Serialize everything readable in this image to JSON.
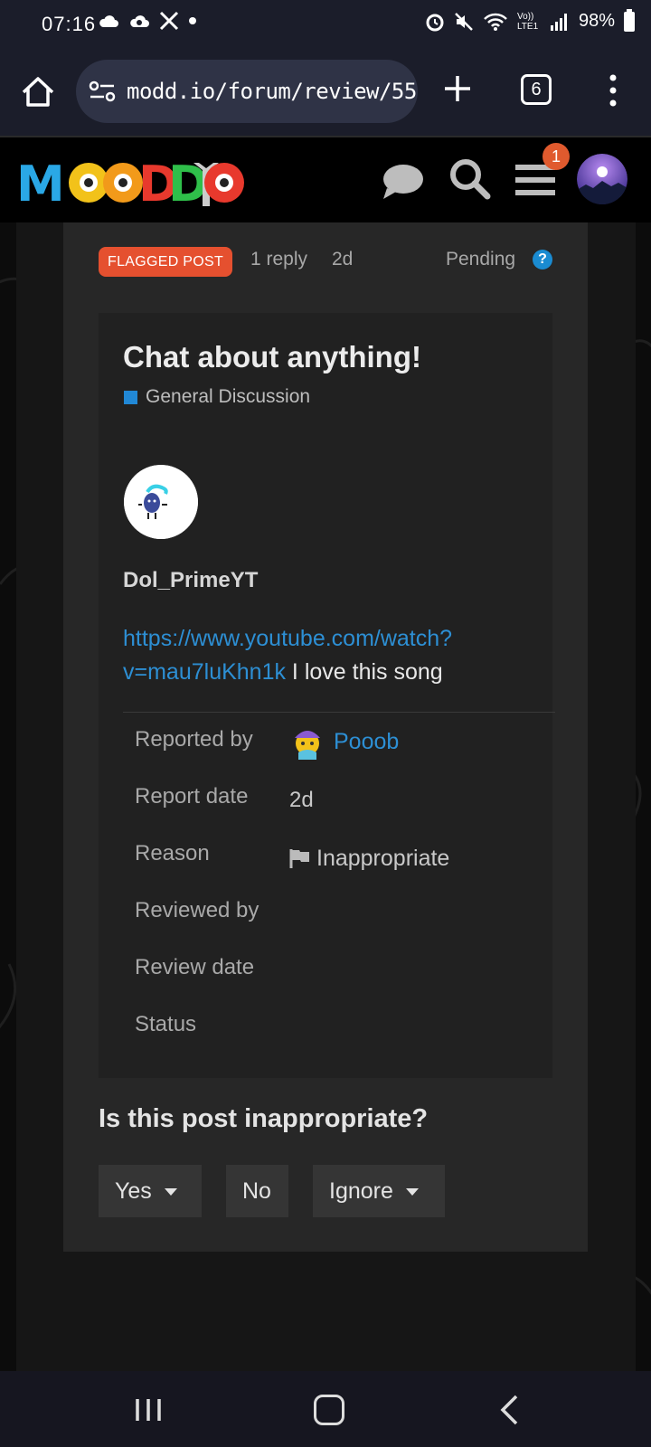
{
  "status_bar": {
    "time": "07:16",
    "network": "Vo)) LTE1",
    "battery": "98%"
  },
  "browser": {
    "url": "modd.io/forum/review/55",
    "tab_count": "6"
  },
  "site_header": {
    "logo_text": "MODD.IO",
    "notification_count": "1"
  },
  "review": {
    "badge": "FLAGGED POST",
    "replies": "1 reply",
    "age": "2d",
    "status": "Pending",
    "help": "?",
    "topic_title": "Chat about anything!",
    "category": "General Discussion",
    "category_color": "#2188d6",
    "author": "Dol_PrimeYT",
    "post_link": "https://www.youtube.com/watch?v=mau7luKhn1k",
    "post_text": " I love this song",
    "rows": {
      "reported_by_label": "Reported by",
      "reported_by_value": "Pooob",
      "report_date_label": "Report date",
      "report_date_value": "2d",
      "reason_label": "Reason",
      "reason_value": "Inappropriate",
      "reviewed_by_label": "Reviewed by",
      "review_date_label": "Review date",
      "status_label": "Status"
    },
    "question": "Is this post inappropriate?",
    "buttons": {
      "yes": "Yes",
      "no": "No",
      "ignore": "Ignore"
    }
  },
  "colors": {
    "accent_link": "#2d8fd4",
    "flag_badge": "#e5502f",
    "notification": "#e05a2e"
  }
}
